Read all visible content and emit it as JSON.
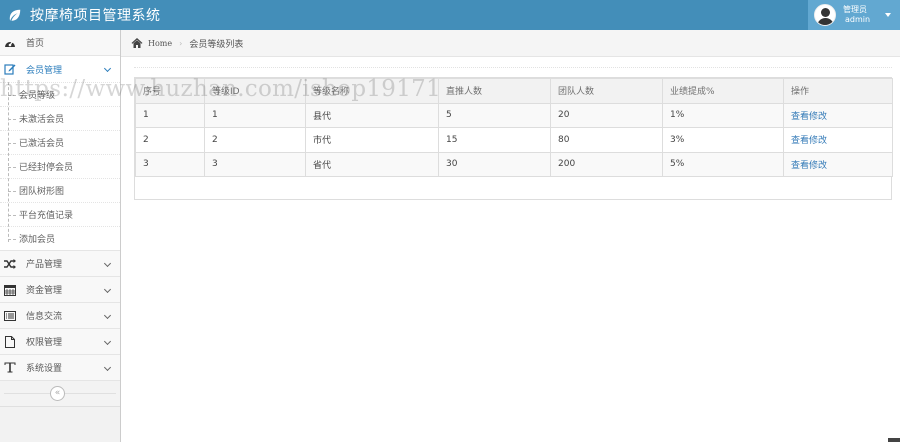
{
  "app": {
    "title": "按摩椅项目管理系统"
  },
  "user": {
    "welcome": "管理员",
    "name": "admin"
  },
  "sidebar": {
    "items": [
      {
        "label": "首页",
        "icon": "dashboard-icon"
      },
      {
        "label": "会员管理",
        "icon": "edit-icon",
        "open": true,
        "children": [
          "会员等级",
          "未激活会员",
          "已激活会员",
          "已经封停会员",
          "团队树形图",
          "平台充值记录",
          "添加会员"
        ]
      },
      {
        "label": "产品管理",
        "icon": "random-icon"
      },
      {
        "label": "资金管理",
        "icon": "calendar-icon"
      },
      {
        "label": "信息交流",
        "icon": "list-icon"
      },
      {
        "label": "权限管理",
        "icon": "file-icon"
      },
      {
        "label": "系统设置",
        "icon": "text-icon"
      }
    ],
    "collapse_glyph": "«"
  },
  "breadcrumb": {
    "home": "Home",
    "separator": "›",
    "current": "会员等级列表"
  },
  "table": {
    "headers": [
      "序号",
      "等级ID",
      "等级名称",
      "直推人数",
      "团队人数",
      "业绩提成%",
      "操作"
    ],
    "rows": [
      [
        "1",
        "1",
        "县代",
        "5",
        "20",
        "1%",
        "查看修改"
      ],
      [
        "2",
        "2",
        "市代",
        "15",
        "80",
        "3%",
        "查看修改"
      ],
      [
        "3",
        "3",
        "省代",
        "30",
        "200",
        "5%",
        "查看修改"
      ]
    ]
  },
  "watermark": "https://www.huzhan.com/ishop19171",
  "colors": {
    "navbar": "#438eb9",
    "user_area": "#62a8d1",
    "link": "#337ab7",
    "active_menu": "#2b7dbc"
  }
}
